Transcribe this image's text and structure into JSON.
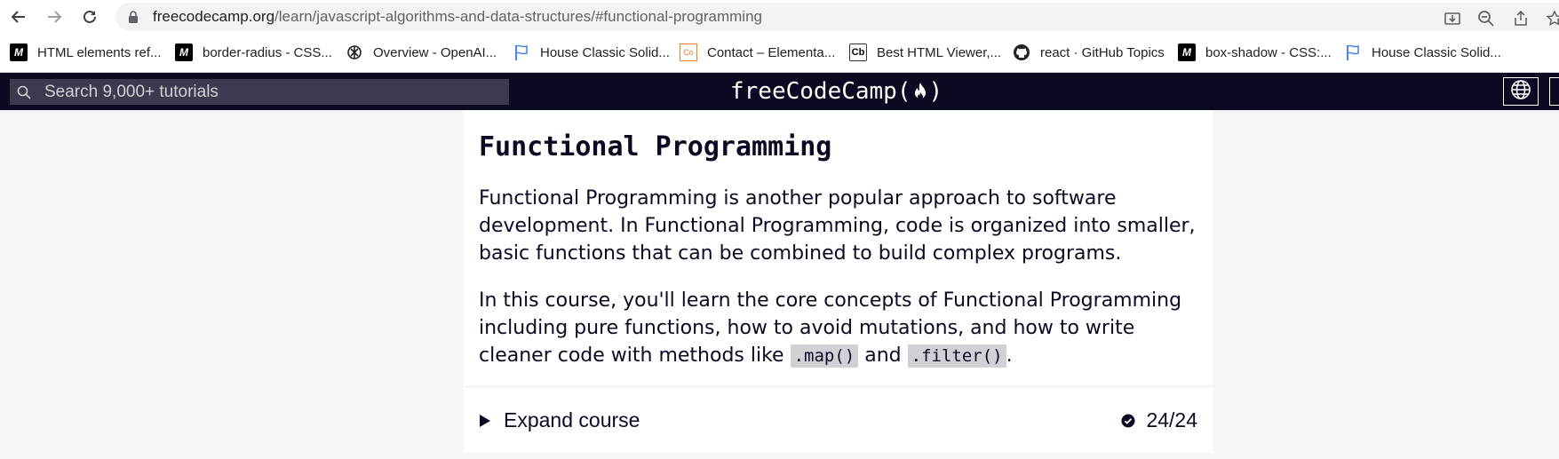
{
  "browser": {
    "url_host": "freecodecamp.org",
    "url_path": "/learn/javascript-algorithms-and-data-structures/#functional-programming",
    "icons": [
      "back-icon",
      "forward-icon",
      "reload-icon",
      "lock-icon",
      "install-icon",
      "zoom-icon",
      "share-icon",
      "star-icon"
    ]
  },
  "bookmarks": [
    {
      "label": "HTML elements ref...",
      "icon": "mdn-icon"
    },
    {
      "label": "border-radius - CSS...",
      "icon": "mdn-icon"
    },
    {
      "label": "Overview - OpenAI...",
      "icon": "openai-icon"
    },
    {
      "label": "House Classic Solid...",
      "icon": "flag-icon"
    },
    {
      "label": "Contact – Elementa...",
      "icon": "co-icon"
    },
    {
      "label": "Best HTML Viewer,...",
      "icon": "cb-icon"
    },
    {
      "label": "react · GitHub Topics",
      "icon": "github-icon"
    },
    {
      "label": "box-shadow - CSS:...",
      "icon": "mdn-icon"
    },
    {
      "label": "House Classic Solid...",
      "icon": "flag-icon"
    }
  ],
  "fcc_nav": {
    "search_placeholder": "Search 9,000+ tutorials",
    "logo_left": "freeCodeCamp(",
    "logo_right": ")"
  },
  "course": {
    "title": "Functional Programming",
    "para1": "Functional Programming is another popular approach to software development. In Functional Programming, code is organized into smaller, basic functions that can be combined to build complex programs.",
    "para2_before": "In this course, you'll learn the core concepts of Functional Programming including pure functions, how to avoid mutations, and how to write cleaner code with methods like ",
    "code1": ".map()",
    "para2_mid": " and ",
    "code2": ".filter()",
    "para2_end": ".",
    "expand_label": "Expand course",
    "progress": "24/24"
  }
}
